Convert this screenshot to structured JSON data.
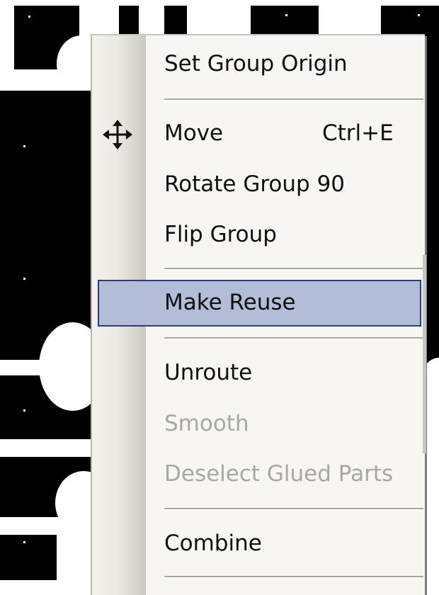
{
  "menu": {
    "items": [
      {
        "label": "Set Group Origin",
        "enabled": true
      },
      {
        "label": "Move",
        "shortcut": "Ctrl+E",
        "icon": "move-arrows-icon",
        "enabled": true
      },
      {
        "label": "Rotate Group 90",
        "enabled": true
      },
      {
        "label": "Flip Group",
        "enabled": true
      },
      {
        "label": "Make Reuse",
        "enabled": true,
        "highlighted": true
      },
      {
        "label": "Unroute",
        "enabled": true
      },
      {
        "label": "Smooth",
        "enabled": false
      },
      {
        "label": "Deselect Glued Parts",
        "enabled": false
      },
      {
        "label": "Combine",
        "enabled": true
      }
    ]
  },
  "colors": {
    "highlight_fill": "#b3bdd7",
    "highlight_border": "#303b79",
    "disabled_text": "#a7a7a3",
    "pcb_copper": "#000000"
  }
}
